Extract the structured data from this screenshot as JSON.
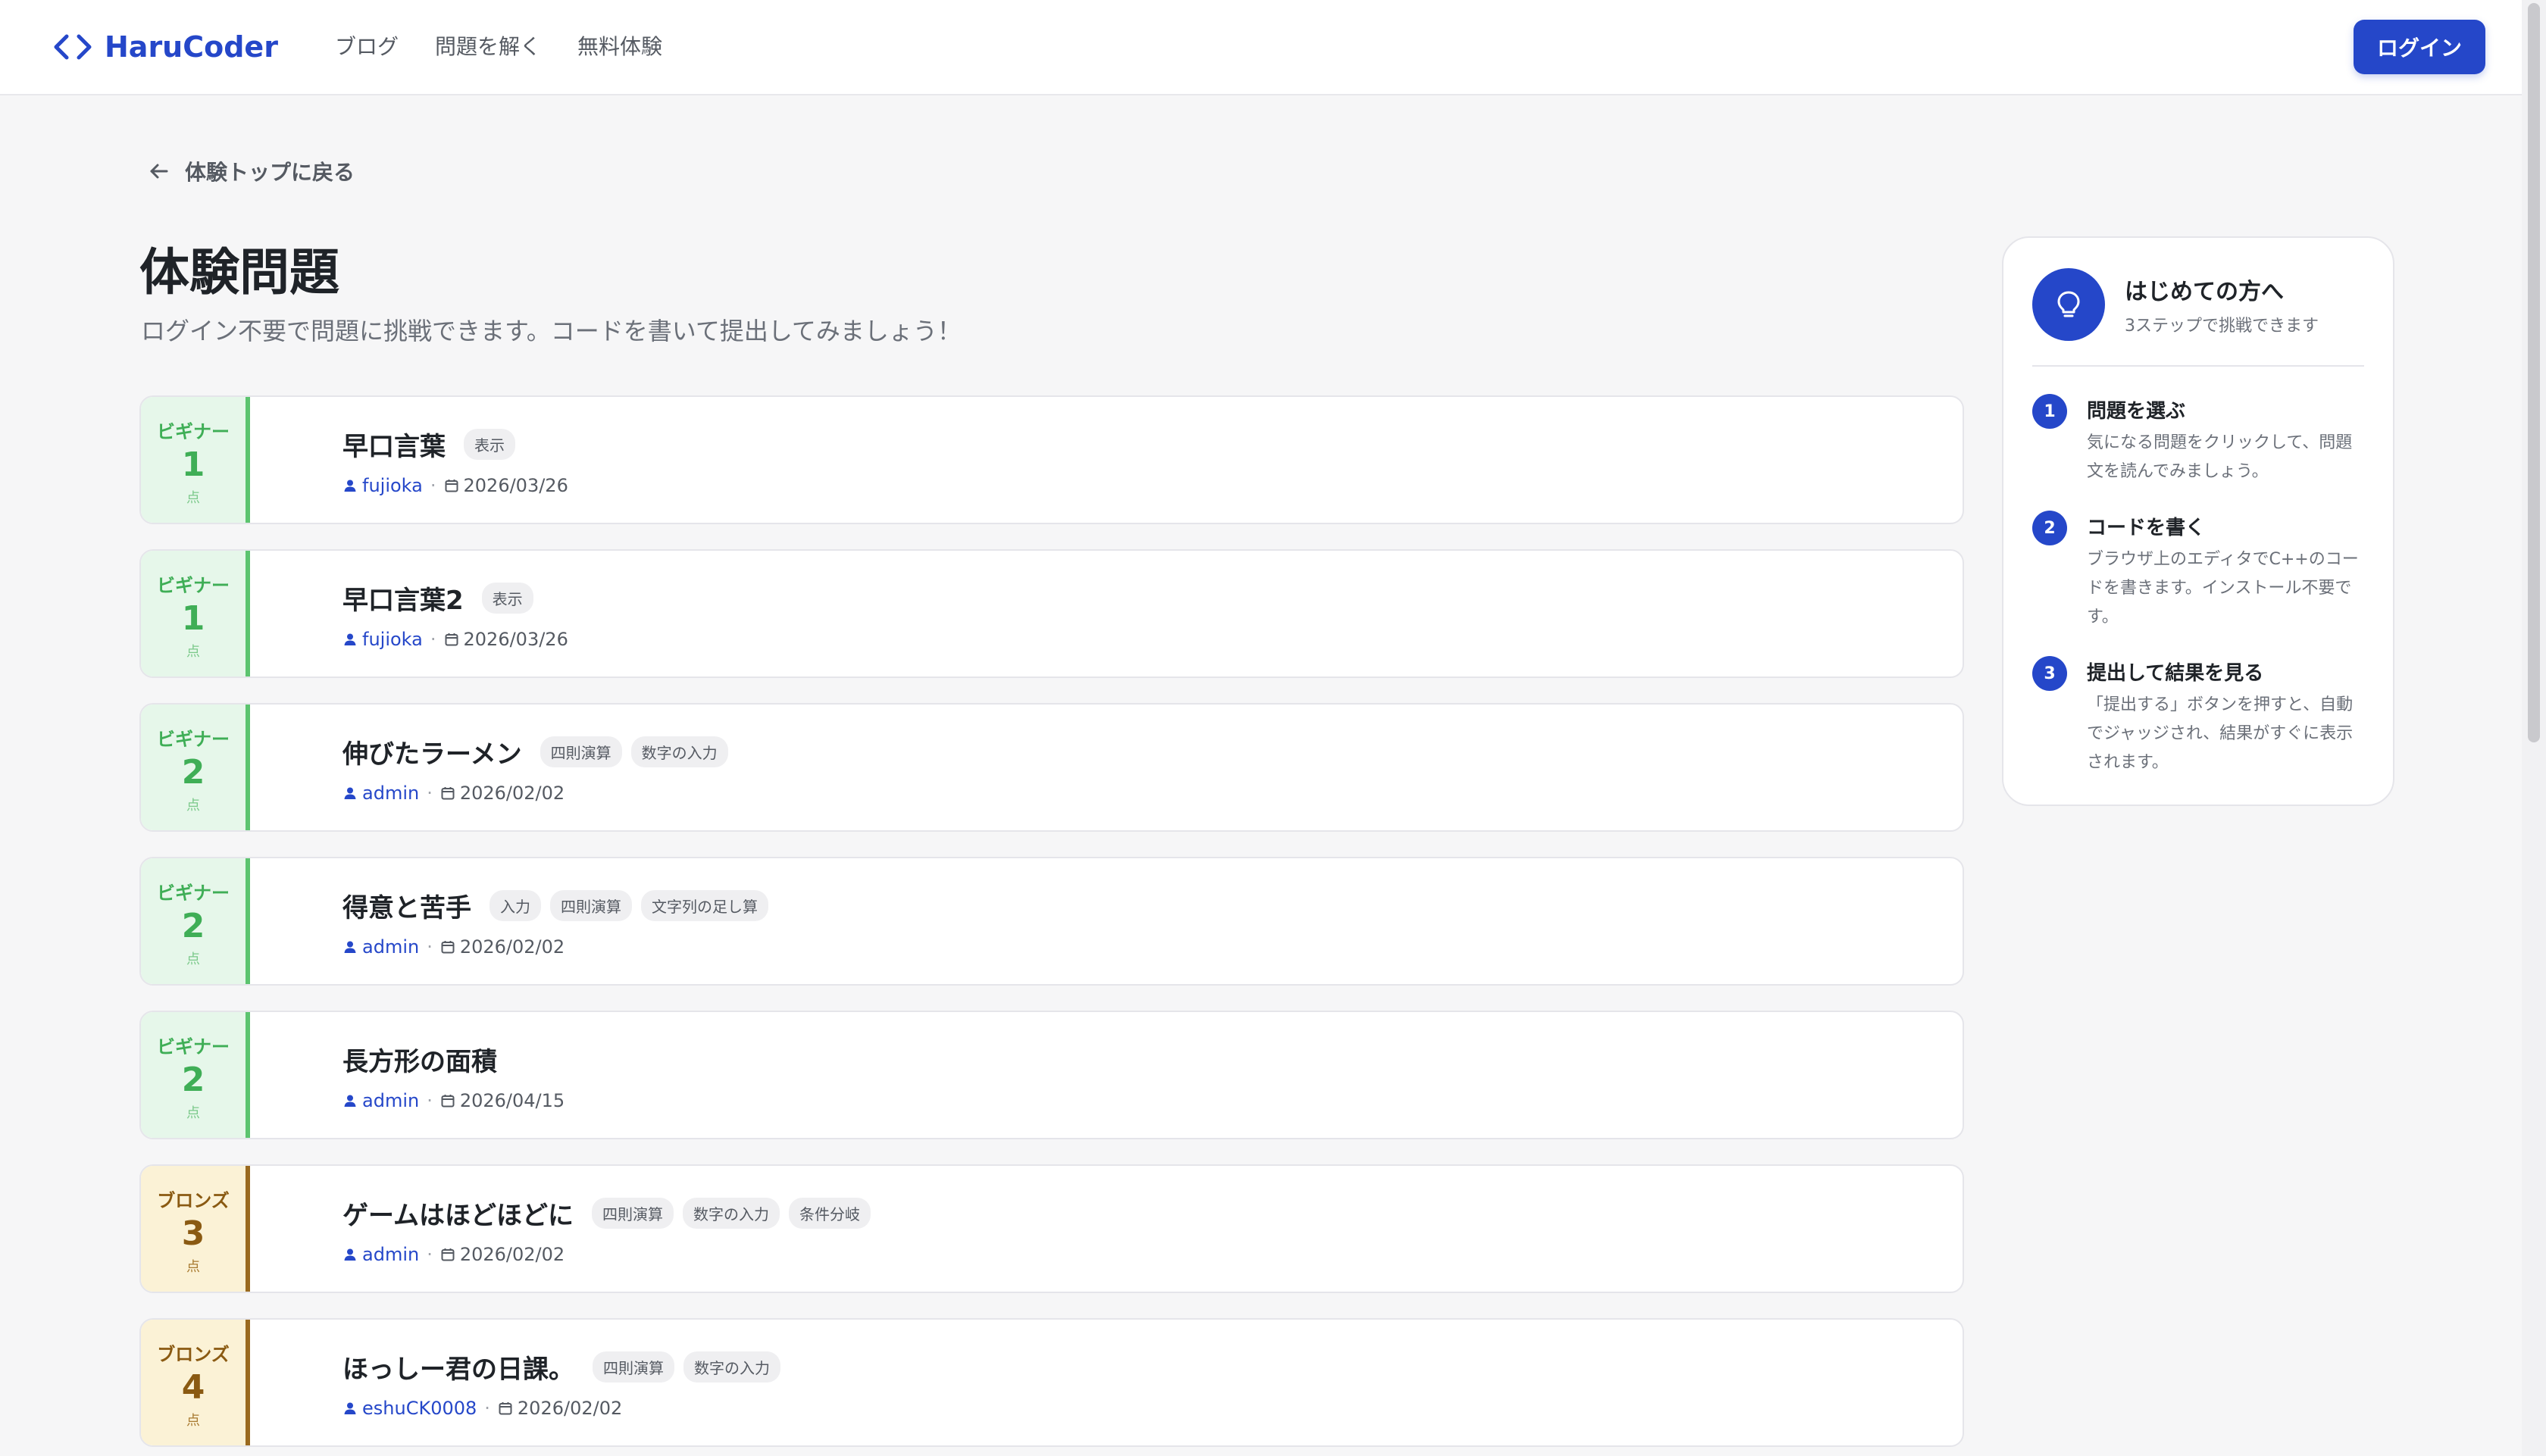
{
  "header": {
    "logo_text": "HaruCoder",
    "nav": [
      "ブログ",
      "問題を解く",
      "無料体験"
    ],
    "login_label": "ログイン"
  },
  "back_link": "体験トップに戻る",
  "page_title": "体験問題",
  "page_subtitle": "ログイン不要で問題に挑戦できます。コードを書いて提出してみましょう！",
  "problems": [
    {
      "rank": "ビギナー",
      "tier": "beginner",
      "points": "1",
      "unit": "点",
      "title": "早口言葉",
      "author": "fujioka",
      "date": "2026/03/26",
      "tags": [
        "表示"
      ]
    },
    {
      "rank": "ビギナー",
      "tier": "beginner",
      "points": "1",
      "unit": "点",
      "title": "早口言葉2",
      "author": "fujioka",
      "date": "2026/03/26",
      "tags": [
        "表示"
      ]
    },
    {
      "rank": "ビギナー",
      "tier": "beginner",
      "points": "2",
      "unit": "点",
      "title": "伸びたラーメン",
      "author": "admin",
      "date": "2026/02/02",
      "tags": [
        "四則演算",
        "数字の入力"
      ]
    },
    {
      "rank": "ビギナー",
      "tier": "beginner",
      "points": "2",
      "unit": "点",
      "title": "得意と苦手",
      "author": "admin",
      "date": "2026/02/02",
      "tags": [
        "入力",
        "四則演算",
        "文字列の足し算"
      ]
    },
    {
      "rank": "ビギナー",
      "tier": "beginner",
      "points": "2",
      "unit": "点",
      "title": "長方形の面積",
      "author": "admin",
      "date": "2026/04/15",
      "tags": []
    },
    {
      "rank": "ブロンズ",
      "tier": "bronze",
      "points": "3",
      "unit": "点",
      "title": "ゲームはほどほどに",
      "author": "admin",
      "date": "2026/02/02",
      "tags": [
        "四則演算",
        "数字の入力",
        "条件分岐"
      ]
    },
    {
      "rank": "ブロンズ",
      "tier": "bronze",
      "points": "4",
      "unit": "点",
      "title": "ほっしー君の日課。",
      "author": "eshuCK0008",
      "date": "2026/02/02",
      "tags": [
        "四則演算",
        "数字の入力"
      ]
    }
  ],
  "guide": {
    "title": "はじめての方へ",
    "subtitle": "3ステップで挑戦できます",
    "steps": [
      {
        "num": "1",
        "title": "問題を選ぶ",
        "desc": "気になる問題をクリックして、問題文を読んでみましょう。"
      },
      {
        "num": "2",
        "title": "コードを書く",
        "desc": "ブラウザ上のエディタでC++のコードを書きます。インストール不要です。"
      },
      {
        "num": "3",
        "title": "提出して結果を見る",
        "desc": "「提出する」ボタンを押すと、自動でジャッジされ、結果がすぐに表示されます。"
      }
    ]
  },
  "colors": {
    "brand": "#2547c9",
    "beginner": "#5cc46f",
    "bronze": "#9a6a1f"
  }
}
